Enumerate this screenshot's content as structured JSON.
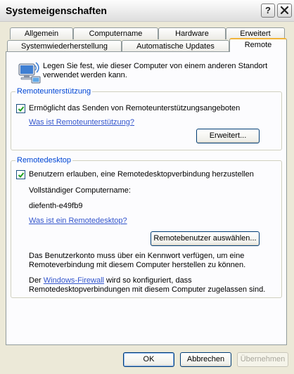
{
  "window": {
    "title": "Systemeigenschaften"
  },
  "titlebar": {
    "help_label": "?",
    "close_label": "✕"
  },
  "tabs": {
    "row1": [
      "Allgemein",
      "Computername",
      "Hardware",
      "Erweitert"
    ],
    "row2": [
      "Systemwiederherstellung",
      "Automatische Updates",
      "Remote"
    ],
    "active": "Remote"
  },
  "intro": {
    "line1": "Legen Sie fest, wie dieser Computer von einem anderen Standort",
    "line2": "verwendet werden kann."
  },
  "remote_assistance": {
    "legend": "Remoteunterstützung",
    "checkbox_label": "Ermöglicht das Senden von Remoteunterstützungsangeboten",
    "checked": true,
    "help_link": "Was ist Remoteunterstützung?",
    "advanced_button": "Erweitert..."
  },
  "remote_desktop": {
    "legend": "Remotedesktop",
    "checkbox_label": "Benutzern erlauben, eine Remotedesktopverbindung herzustellen",
    "checked": true,
    "computername_label": "Vollständiger Computername:",
    "computername_value": "diefenth-e49fb9",
    "help_link": "Was ist ein Remotedesktop?",
    "select_users_button": "Remotebenutzer auswählen...",
    "note1_line1": "Das Benutzerkonto muss über ein Kennwort verfügen, um eine",
    "note1_line2": "Remoteverbindung mit diesem Computer herstellen zu können.",
    "note2_prefix": "Der ",
    "note2_link": "Windows-Firewall",
    "note2_suffix": " wird so konfiguriert, dass",
    "note2_line2": "Remotedesktopverbindungen mit diesem Computer zugelassen sind."
  },
  "footer": {
    "ok": "OK",
    "cancel": "Abbrechen",
    "apply": "Übernehmen"
  }
}
